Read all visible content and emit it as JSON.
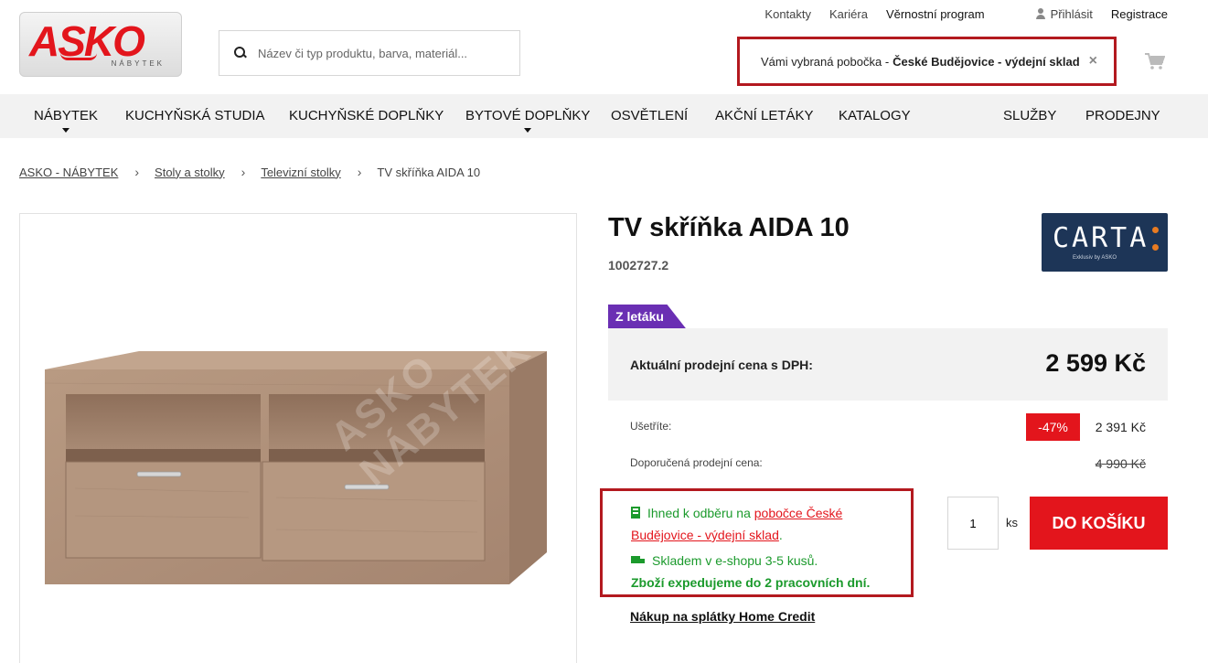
{
  "header": {
    "logo_text": "ASKO",
    "logo_sub": "NÁBYTEK",
    "search_placeholder": "Název či typ produktu, barva, materiál...",
    "top_links": {
      "contacts": "Kontakty",
      "career": "Kariéra",
      "loyalty": "Věrnostní program",
      "login": "Přihlásit",
      "register": "Registrace"
    },
    "branch": {
      "prefix": "Vámi vybraná pobočka -",
      "name": "České Budějovice - výdejní sklad",
      "close": "×"
    },
    "cart_icon": "cart-icon",
    "colors": {
      "brand_red": "#e3151c",
      "highlight_border": "#b3191f"
    }
  },
  "nav": {
    "items": [
      {
        "label": "Nábytek",
        "has_dropdown": true
      },
      {
        "label": "Kuchyňská studia",
        "has_dropdown": false
      },
      {
        "label": "Kuchyňské doplňky",
        "has_dropdown": false
      },
      {
        "label": "Bytové doplňky",
        "has_dropdown": true
      },
      {
        "label": "Osvětlení",
        "has_dropdown": false
      },
      {
        "label": "Akční letáky",
        "has_dropdown": false
      },
      {
        "label": "Katalogy",
        "has_dropdown": false
      },
      {
        "label": "Služby",
        "has_dropdown": false
      },
      {
        "label": "Prodejny",
        "has_dropdown": false
      }
    ]
  },
  "breadcrumb": {
    "items": [
      "ASKO - NÁBYTEK",
      "Stoly a stolky",
      "Televizní stolky"
    ],
    "current": "TV skříňka AIDA 10",
    "separator": "›"
  },
  "product": {
    "image_watermark": "ASKO NÁBYTEK",
    "title": "TV skříňka AIDA 10",
    "sku": "1002727.2",
    "brand": {
      "name": "CARTA",
      "tagline": "Exklusiv by ASKO",
      "color": "#1d3557"
    },
    "badge": "Z letáku",
    "badge_color": "#6a2fb3",
    "price_label": "Aktuální prodejní cena s DPH:",
    "price": "2 599 Kč",
    "saving_label": "Ušetříte:",
    "discount": "-47%",
    "saving": "2 391 Kč",
    "rrp_label": "Doporučená prodejní cena:",
    "rrp": "4 990 Kč",
    "availability": {
      "store_prefix": "Ihned k odběru na",
      "store_link": "pobočce České Budějovice - výdejní sklad",
      "store_suffix": ".",
      "eshop": "Skladem v e-shopu 3-5 kusů.",
      "shipping": "Zboží expedujeme do 2 pracovních dní.",
      "color": "#1b9a2c"
    },
    "quantity": "1",
    "quantity_unit": "ks",
    "add_to_cart": "Do košíku",
    "credit_link": "Nákup na splátky Home Credit"
  }
}
